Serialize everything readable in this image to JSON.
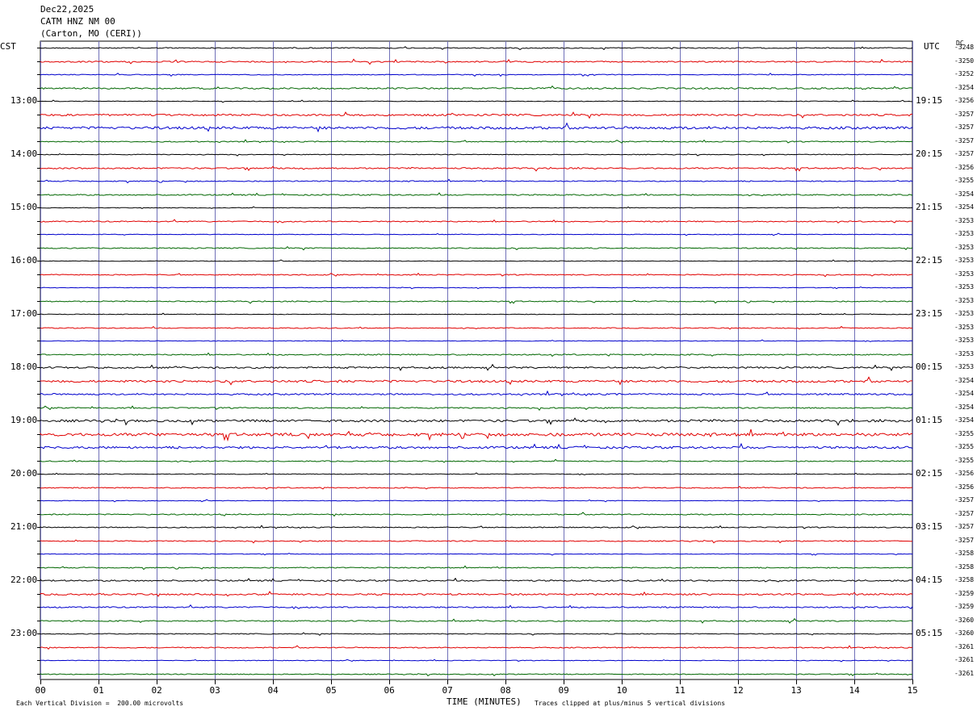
{
  "header": {
    "date": "Dec22,2025",
    "station": "CATM HNZ NM 00",
    "location": "(Carton, MO (CERI))",
    "left_tz": "CST",
    "right_tz": "UTC",
    "dc_label": "DC"
  },
  "footer": {
    "scale_note": "Each Vertical Division =  200.00 microvolts",
    "x_axis_title": "TIME (MINUTES)",
    "clip_note": "Traces clipped at plus/minus 5 vertical divisions"
  },
  "chart_data": {
    "type": "line",
    "title": "CATM HNZ NM 00",
    "xlabel": "TIME (MINUTES)",
    "xlim": [
      0,
      15
    ],
    "x_ticks": [
      "00",
      "01",
      "02",
      "03",
      "04",
      "05",
      "06",
      "07",
      "08",
      "09",
      "10",
      "11",
      "12",
      "13",
      "14",
      "15"
    ],
    "rows_per_hour": 4,
    "line_colors": [
      "#000000",
      "#e00000",
      "#0000cc",
      "#006600"
    ],
    "grid_color": "#7070b8",
    "left_hour_labels": [
      "13:00",
      "14:00",
      "15:00",
      "16:00",
      "17:00",
      "18:00",
      "19:00",
      "20:00",
      "21:00",
      "22:00",
      "23:00"
    ],
    "right_hour_labels": [
      "19:15",
      "20:15",
      "21:15",
      "22:15",
      "23:15",
      "00:15",
      "01:15",
      "02:15",
      "03:15",
      "04:15",
      "05:15"
    ],
    "dc_offsets": [
      "-3248",
      "-3250",
      "-3252",
      "-3254",
      "-3256",
      "-3257",
      "-3257",
      "-3257",
      "-3257",
      "-3256",
      "-3255",
      "-3254",
      "-3254",
      "-3253",
      "-3253",
      "-3253",
      "-3253",
      "-3253",
      "-3253",
      "-3253",
      "-3253",
      "-3253",
      "-3253",
      "-3253",
      "-3253",
      "-3254",
      "-3254",
      "-3254",
      "-3254",
      "-3255",
      "-3255",
      "-3255",
      "-3256",
      "-3256",
      "-3257",
      "-3257",
      "-3257",
      "-3257",
      "-3258",
      "-3258",
      "-3258",
      "-3259",
      "-3259",
      "-3260",
      "-3260",
      "-3261",
      "-3261",
      "-3261"
    ],
    "trace_noise": [
      1.0,
      1.3,
      0.8,
      1.5,
      0.6,
      1.8,
      2.5,
      1.0,
      0.7,
      1.4,
      1.0,
      1.2,
      0.6,
      1.1,
      0.6,
      1.0,
      0.6,
      1.0,
      0.6,
      1.0,
      0.6,
      0.9,
      0.6,
      1.2,
      1.6,
      2.2,
      1.6,
      1.2,
      2.2,
      3.0,
      2.2,
      1.0,
      0.7,
      1.0,
      0.6,
      1.1,
      1.0,
      1.0,
      0.6,
      1.0,
      1.4,
      1.6,
      1.3,
      1.2,
      0.8,
      1.0,
      0.6,
      0.9
    ]
  }
}
